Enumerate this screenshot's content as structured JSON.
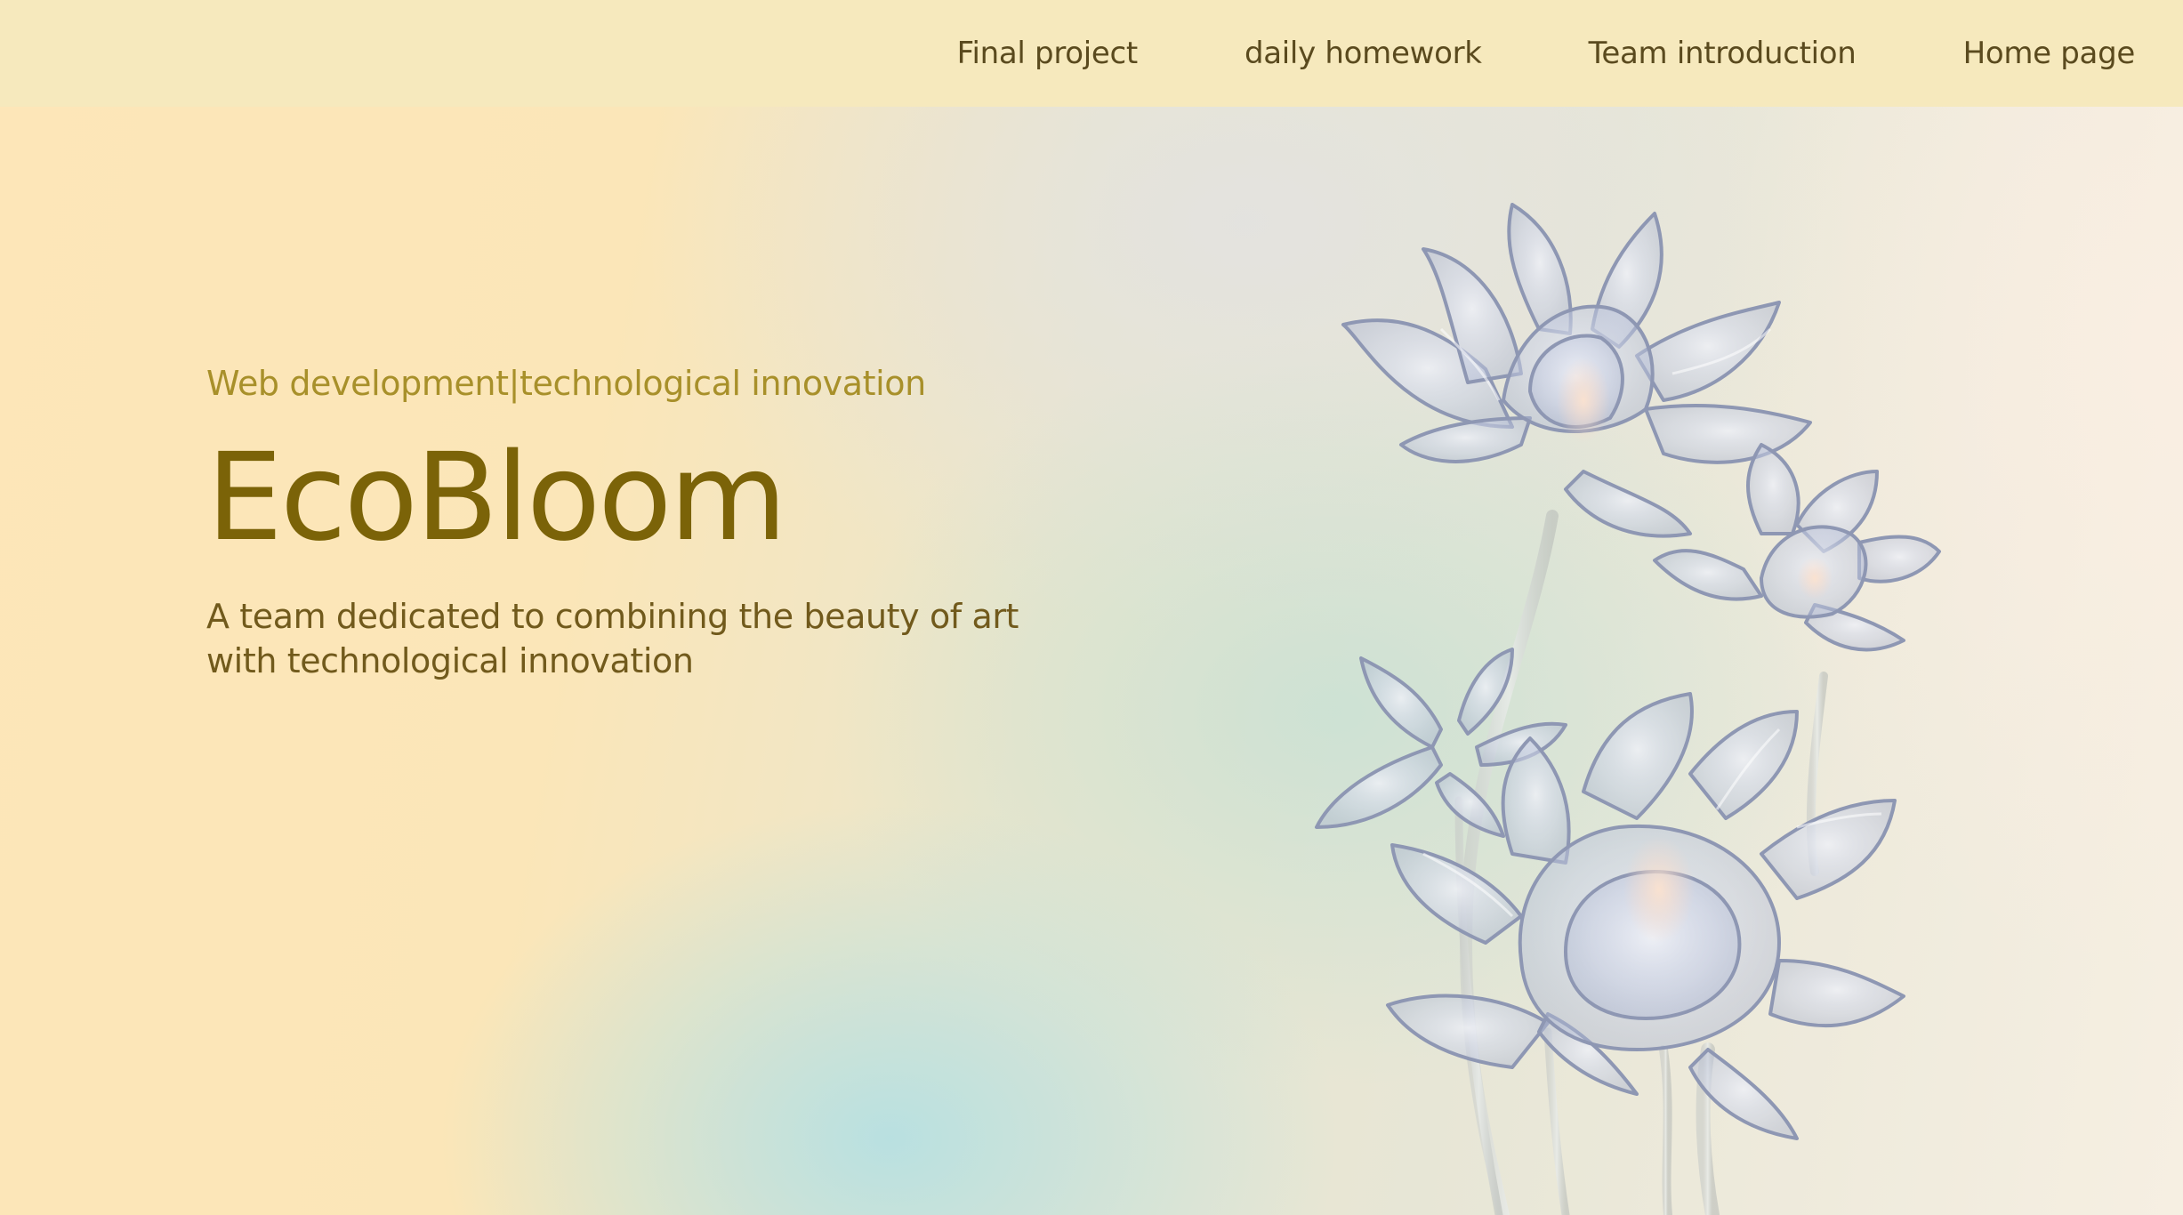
{
  "nav": {
    "items": [
      {
        "label": "Final project"
      },
      {
        "label": "daily homework"
      },
      {
        "label": "Team introduction"
      },
      {
        "label": "Home page"
      }
    ]
  },
  "hero": {
    "tagline": "Web development|technological innovation",
    "title": "EcoBloom",
    "description": "A team dedicated to combining the beauty of art with technological innovation"
  },
  "illustration": {
    "icon": "glass-flowers-illustration"
  },
  "colors": {
    "nav_background": "#f6e9bd",
    "nav_text": "#5a4a1e",
    "tagline": "#a8902a",
    "title": "#7b6308",
    "description": "#715a1c"
  }
}
